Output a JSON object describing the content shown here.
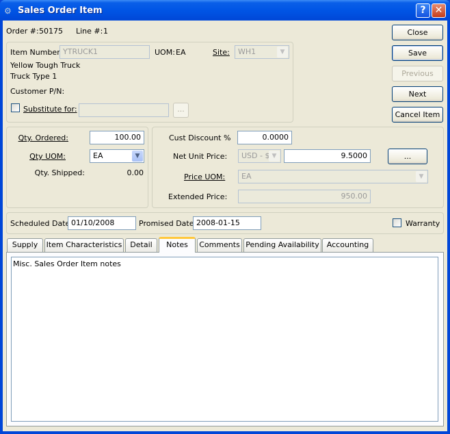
{
  "window": {
    "title": "Sales Order Item",
    "help": "?",
    "close": "✕"
  },
  "header": {
    "order_label": "Order #:",
    "order_value": "50175",
    "line_label": "Line #:",
    "line_value": "1"
  },
  "item": {
    "item_number_label": "Item Number:",
    "item_number": "YTRUCK1",
    "uom_label": "UOM:",
    "uom": "EA",
    "site_label": "Site:",
    "site": "WH1",
    "description1": "Yellow Tough Truck",
    "description2": "Truck Type 1",
    "customer_pn_label": "Customer P/N:",
    "substitute_label": "Substitute for:",
    "substitute_value": "",
    "ellipsis": "..."
  },
  "buttons": {
    "close": "Close",
    "save": "Save",
    "previous": "Previous",
    "next": "Next",
    "cancel_item": "Cancel Item"
  },
  "qty": {
    "ordered_label": "Qty. Ordered:",
    "ordered": "100.00",
    "uom_label": "Qty UOM:",
    "uom": "EA",
    "shipped_label": "Qty. Shipped:",
    "shipped": "0.00"
  },
  "price": {
    "discount_label": "Cust Discount %",
    "discount": "0.0000",
    "net_label": "Net Unit Price:",
    "currency": "USD - $",
    "net": "9.5000",
    "ellipsis": "...",
    "price_uom_label": "Price UOM:",
    "price_uom": "EA",
    "extended_label": "Extended Price:",
    "extended": "950.00"
  },
  "dates": {
    "scheduled_label": "Scheduled Date:",
    "scheduled": "01/10/2008",
    "promised_label": "Promised Date:",
    "promised": "2008-01-15",
    "warranty_label": "Warranty"
  },
  "tabs": [
    "Supply",
    "Item Characteristics",
    "Detail",
    "Notes",
    "Comments",
    "Pending Availability",
    "Accounting"
  ],
  "notes": {
    "text": "Misc. Sales Order Item notes"
  }
}
